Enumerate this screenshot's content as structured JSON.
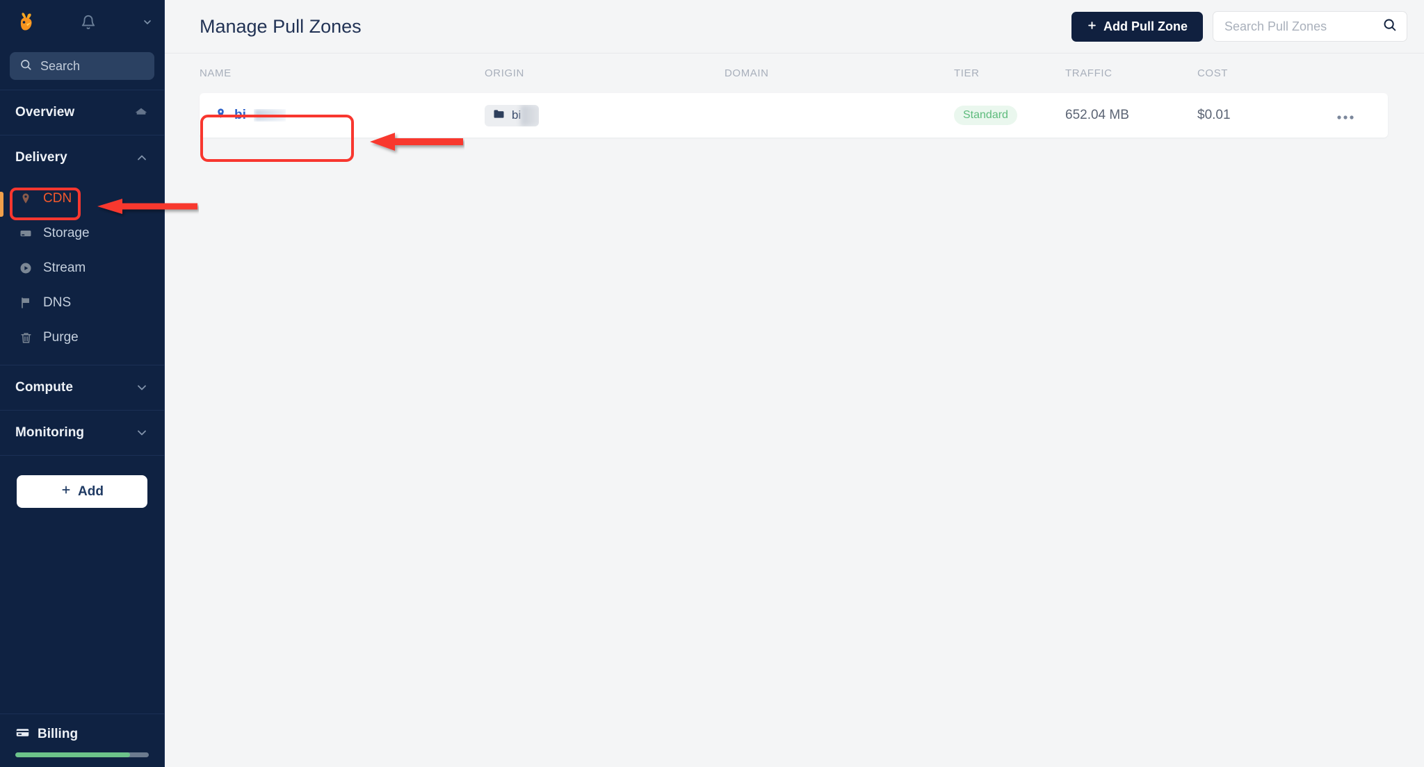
{
  "app": {
    "brand_icon": "bunny-logo-icon",
    "accent_orange": "#f4582c",
    "sidebar_bg": "#0f2242",
    "annotation_red": "#f8372f"
  },
  "sidebar": {
    "topbar": {
      "notifications_icon": "bell-icon",
      "avatar_icon": "avatar",
      "account_chevron_icon": "chevron-down-icon"
    },
    "search": {
      "placeholder": "Search",
      "icon": "search-icon"
    },
    "groups": [
      {
        "label": "Overview",
        "icon": "home-icon",
        "expanded": false,
        "items": []
      },
      {
        "label": "Delivery",
        "icon": "chevron-up-icon",
        "expanded": true,
        "items": [
          {
            "label": "CDN",
            "icon": "map-pin-icon",
            "active": true
          },
          {
            "label": "Storage",
            "icon": "drive-icon",
            "active": false
          },
          {
            "label": "Stream",
            "icon": "play-circle-icon",
            "active": false
          },
          {
            "label": "DNS",
            "icon": "flag-icon",
            "active": false
          },
          {
            "label": "Purge",
            "icon": "trash-icon",
            "active": false
          }
        ]
      },
      {
        "label": "Compute",
        "icon": "chevron-down-icon",
        "expanded": false,
        "items": []
      },
      {
        "label": "Monitoring",
        "icon": "chevron-down-icon",
        "expanded": false,
        "items": []
      }
    ],
    "add_button": {
      "label": "Add",
      "icon": "plus-icon"
    },
    "billing": {
      "label": "Billing",
      "icon": "credit-card-icon",
      "balance_redacted": true,
      "usage_percent": 86
    }
  },
  "header": {
    "title": "Manage Pull Zones",
    "add_pull_zone": {
      "label": "Add Pull Zone",
      "icon": "plus-icon"
    },
    "search": {
      "placeholder": "Search Pull Zones",
      "value": "",
      "icon": "search-icon"
    }
  },
  "table": {
    "columns": [
      "NAME",
      "ORIGIN",
      "DOMAIN",
      "TIER",
      "TRAFFIC",
      "COST"
    ],
    "rows": [
      {
        "name": "bi",
        "name_redacted": true,
        "name_icon": "map-pin-icon",
        "origin": "bi",
        "origin_redacted": true,
        "origin_icon": "folder-icon",
        "domain": "",
        "tier": "Standard",
        "traffic": "652.04 MB",
        "cost": "$0.01",
        "actions_icon": "ellipsis-icon"
      }
    ]
  },
  "annotations": [
    {
      "type": "box",
      "target": "sidebar-item-cdn"
    },
    {
      "type": "arrow",
      "target": "sidebar-item-cdn",
      "direction": "left"
    },
    {
      "type": "box",
      "target": "pull-zone-name-cell"
    },
    {
      "type": "arrow",
      "target": "pull-zone-name-cell",
      "direction": "left"
    }
  ]
}
